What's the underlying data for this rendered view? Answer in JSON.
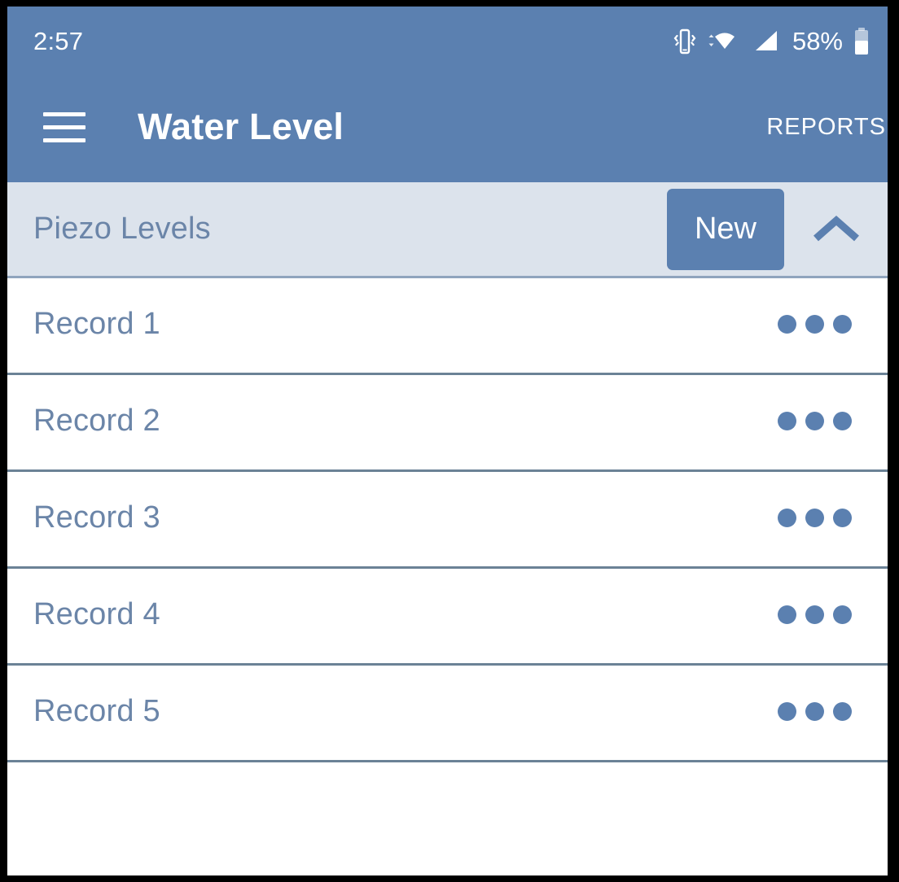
{
  "colors": {
    "primary": "#5b80b0",
    "section_bg": "#dce3ec",
    "text_blue": "#6b85a8",
    "divider": "#6b8296",
    "section_divider": "#8fa4bd",
    "white": "#ffffff",
    "bezel": "#000000"
  },
  "status_bar": {
    "clock": "2:57",
    "battery_percent": "58%",
    "icons": [
      "vibrate-icon",
      "wifi-icon",
      "cellular-signal-icon",
      "battery-icon"
    ]
  },
  "app_bar": {
    "menu_icon": "hamburger-menu-icon",
    "title": "Water Level",
    "action_label": "REPORTS"
  },
  "section": {
    "title": "Piezo Levels",
    "new_label": "New",
    "collapse_icon": "chevron-up-icon",
    "expanded": true
  },
  "records": [
    {
      "label": "Record 1",
      "menu_icon": "overflow-menu-icon"
    },
    {
      "label": "Record 2",
      "menu_icon": "overflow-menu-icon"
    },
    {
      "label": "Record 3",
      "menu_icon": "overflow-menu-icon"
    },
    {
      "label": "Record 4",
      "menu_icon": "overflow-menu-icon"
    },
    {
      "label": "Record 5",
      "menu_icon": "overflow-menu-icon"
    }
  ]
}
